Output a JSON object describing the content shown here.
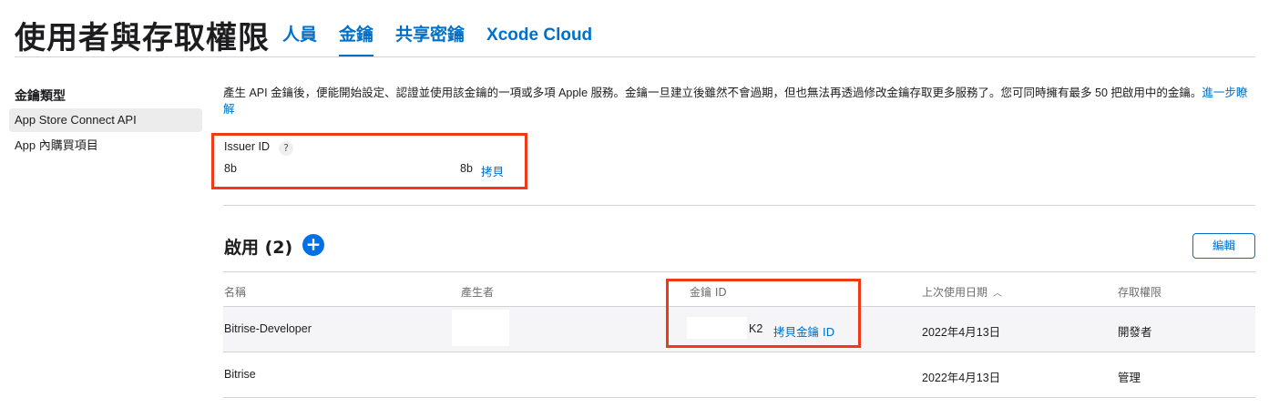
{
  "header": {
    "title": "使用者與存取權限",
    "tabs": [
      {
        "label": "人員"
      },
      {
        "label": "金鑰"
      },
      {
        "label": "共享密鑰"
      },
      {
        "label": "Xcode Cloud"
      }
    ]
  },
  "sidebar": {
    "heading": "金鑰類型",
    "items": [
      {
        "label": "App Store Connect API"
      },
      {
        "label": "App 內購買項目"
      }
    ]
  },
  "intro": {
    "text": "產生 API 金鑰後，便能開始設定、認證並使用該金鑰的一項或多項 Apple 服務。金鑰一旦建立後雖然不會過期，但也無法再透過修改金鑰存取更多服務了。您可同時擁有最多 50 把啟用中的金鑰。",
    "link": "進一步瞭解"
  },
  "issuer": {
    "label": "Issuer ID",
    "help": "?",
    "value_start": "8b",
    "value_end": "8b",
    "copy_label": "拷貝"
  },
  "active": {
    "heading": "啟用 (2)",
    "add_symbol": "+",
    "edit_label": "編輯"
  },
  "table": {
    "columns": [
      "名稱",
      "產生者",
      "金鑰 ID",
      "上次使用日期",
      "存取權限"
    ],
    "sort_icon": "︿",
    "rows": [
      {
        "name": "Bitrise-Developer",
        "key_id_end": "K2",
        "copy_key": "拷貝金鑰 ID",
        "last_used": "2022年4月13日",
        "access": "開發者"
      },
      {
        "name": "Bitrise",
        "last_used": "2022年4月13日",
        "access": "管理"
      }
    ]
  },
  "colors": {
    "accent": "#0070c9",
    "annotation": "#f03a17",
    "highlight_row": "#f5f5f7"
  }
}
